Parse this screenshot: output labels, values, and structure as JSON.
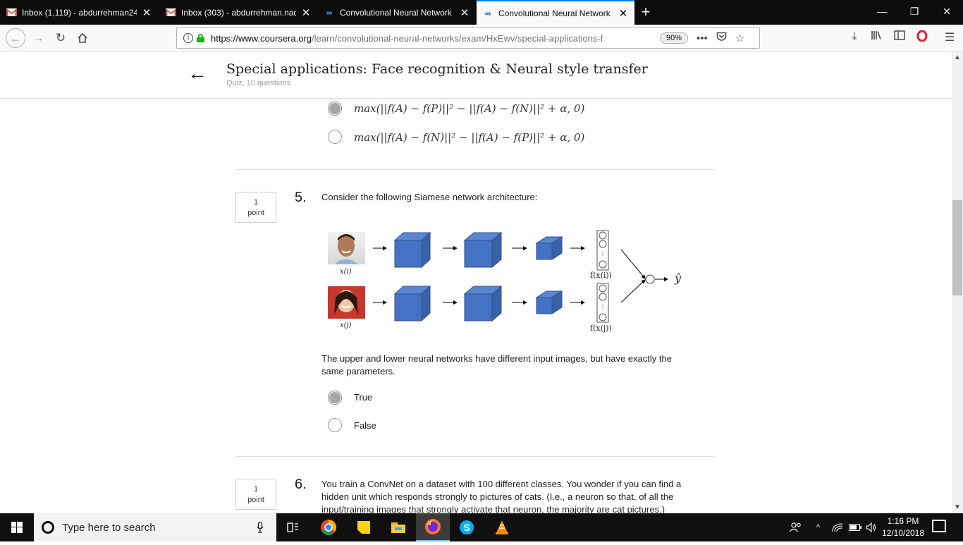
{
  "browser": {
    "tabs": [
      {
        "title": "Inbox (1,119) - abdurrehman24",
        "icon": "gmail-icon",
        "active": false
      },
      {
        "title": "Inbox (303) - abdurrehman.nad",
        "icon": "gmail-icon",
        "active": false
      },
      {
        "title": "Convolutional Neural Network",
        "icon": "coursera-icon",
        "active": false
      },
      {
        "title": "Convolutional Neural Network",
        "icon": "coursera-icon",
        "active": true
      }
    ],
    "url_host": "https://www.coursera.org",
    "url_path": "/learn/convolutional-neural-networks/exam/HxEwv/special-applications-f",
    "zoom": "90%"
  },
  "header": {
    "title": "Special applications: Face recognition & Neural style transfer",
    "subtitle": "Quiz, 10 questions"
  },
  "question4": {
    "options": [
      {
        "text": "max(||f(A) − f(P)||² − ||f(A) − f(N)||² + α, 0)",
        "selected": true
      },
      {
        "text": "max(||f(A) − f(N)||² − ||f(A) − f(P)||² + α, 0)",
        "selected": false
      }
    ]
  },
  "question5": {
    "number": "5.",
    "points_value": "1",
    "points_label": "point",
    "prompt": "Consider the following Siamese network architecture:",
    "statement": "The upper and lower neural networks have different input images, but have exactly the same parameters.",
    "diagram": {
      "label_top_input": "x(i)",
      "label_bottom_input": "x(j)",
      "label_top_output": "f(x(i))",
      "label_bottom_output": "f(x(j))",
      "label_result": "ŷ",
      "cube_color": "#4472c4"
    },
    "options": [
      {
        "label": "True",
        "selected": true
      },
      {
        "label": "False",
        "selected": false
      }
    ]
  },
  "question6": {
    "number": "6.",
    "points_value": "1",
    "points_label": "point",
    "prompt": "You train a ConvNet on a dataset with 100 different classes. You wonder if you can find a hidden unit which responds strongly to pictures of cats. (I.e., a neuron so that, of all the input/training images that strongly activate that neuron, the majority are cat pictures.)"
  },
  "taskbar": {
    "search_placeholder": "Type here to search",
    "time": "1:16 PM",
    "date": "12/10/2018"
  },
  "colors": {
    "accent": "#0a84ff",
    "secure_green": "#12bc00",
    "selected_radio": "#a6a6a6"
  }
}
